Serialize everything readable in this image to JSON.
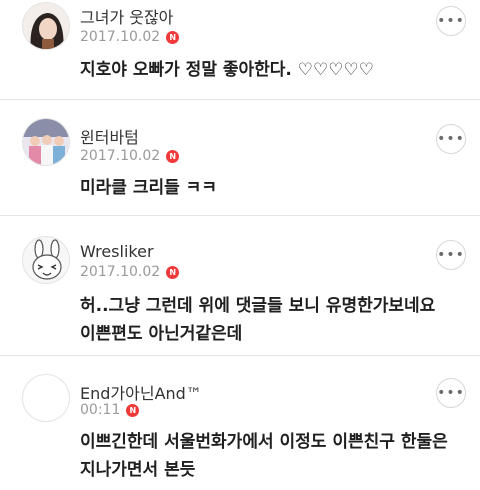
{
  "comments": [
    {
      "author": "그녀가 웃잖아",
      "date": "2017.10.02",
      "new_badge": "N",
      "text_lines": [
        "지호야 오빠가 정말 좋아한다. ♡♡♡♡♡"
      ],
      "more_icon": "more-horizontal-icon"
    },
    {
      "author": "윈터바텀",
      "date": "2017.10.02",
      "new_badge": "N",
      "text_lines": [
        "미라클 크리들 ㅋㅋ"
      ],
      "more_icon": "more-horizontal-icon"
    },
    {
      "author": "Wresliker",
      "date": "2017.10.02",
      "new_badge": "N",
      "text_lines": [
        "허..그냥 그런데 위에 댓글들 보니 유명한가보네요",
        "이쁜편도 아닌거같은데"
      ],
      "more_icon": "more-horizontal-icon"
    },
    {
      "author": "End가아닌And™",
      "date": "00:11",
      "new_badge": "N",
      "text_lines": [
        "이쁘긴한데 서울번화가에서 이정도 이쁜친구 한둘은",
        "지나가면서 본듯"
      ],
      "more_icon": "more-horizontal-icon"
    }
  ],
  "colors": {
    "badge": "#f03a3a",
    "divider": "#e6e6e6",
    "meta_text": "#9a9a9a"
  }
}
